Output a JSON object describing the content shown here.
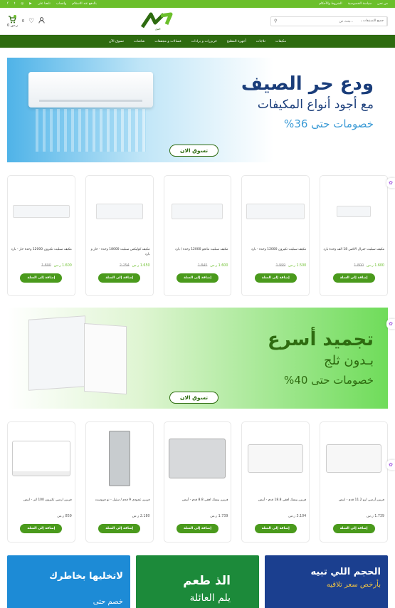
{
  "topbar": {
    "left_links": [
      "من نحن",
      "سياسة الخصوصية",
      "الشروط والأحكام"
    ],
    "right_info": [
      "تابعنا على",
      "واتساب",
      "بالدفع عند الاستلام"
    ]
  },
  "header": {
    "cart_amount": "0 ر.س",
    "cart_count": "0",
    "logo_text": "النيل",
    "search_category": "جميع التصنيفات",
    "search_placeholder": "بحث عن..."
  },
  "nav": [
    "مكيفات",
    "ثلاجات",
    "أجهزة المطبخ",
    "فريزرات و برادات",
    "غسالات و مجففات",
    "شاشات",
    "تسوق الآن"
  ],
  "banner1": {
    "headline": "ودع حر الصيف",
    "subline": "مع أجود أنواع المكيفات",
    "discount": "خصومات حتى 36%",
    "cta": "تسوق الان"
  },
  "banner2": {
    "headline": "تجميد أسرع",
    "subline": "بـدون ثلج",
    "discount": "خصومات حتى 40%",
    "cta": "تسوق الان"
  },
  "products_ac": [
    {
      "title": "مكيف سبليت جنرال الاكس 18 الف وحدة بارد",
      "old": "1.800",
      "new": "1.600 ر.س",
      "btn": "إضافة إلى السلة"
    },
    {
      "title": "مكيف سبليت تكيرون 12000 وحدة - بارد",
      "old": "1.999",
      "new": "1.500 ر.س",
      "btn": "إضافة إلى السلة"
    },
    {
      "title": "مكيف سبليت مانجو 12000 وحدة / بارد",
      "old": "1.845",
      "new": "1.600 ر.س",
      "btn": "إضافة إلى السلة"
    },
    {
      "title": "مكيف كوليكس سبليت 18000 وحدة - حار و بارد",
      "old": "2.254",
      "new": "1.650 ر.س",
      "btn": "إضافة إلى السلة"
    },
    {
      "title": "مكيف سبليت تكيرون 12000 وحدة حار - بارد",
      "old": "1.800",
      "new": "1.600 ر.س",
      "btn": "إضافة إلى السلة"
    }
  ],
  "products_fridge": [
    {
      "title": "فريزر أرضي ارو 11.2 قدم - ابيض",
      "new": "1.739 ر.س",
      "btn": "إضافة إلى السلة"
    },
    {
      "title": "فريزر بيسك افقي 18.8 قدم - أبيض",
      "new": "3.104 ر.س",
      "btn": "إضافة إلى السلة"
    },
    {
      "title": "فريزر بيسك افقي 8.8 قدم - أبيض",
      "new": "1.739 ر.س",
      "btn": "إضافة إلى السلة"
    },
    {
      "title": "فريزر عمودي 9 قدم / ستيل - نو فروست",
      "new": "2.180 ر.س",
      "btn": "إضافة إلى السلة"
    },
    {
      "title": "فريزر ارضي تكيرون 100 لتر - ابيض",
      "new": "859 ر.س",
      "btn": "إضافة إلى السلة"
    }
  ],
  "promos": [
    {
      "title": "الحجم اللي تبيه",
      "sub": "بأرخص سعر تلاقيه",
      "color": "#1b3f8f"
    },
    {
      "title": "الذ طعم",
      "sub": "يلم العائلة",
      "color": "#1c8a3a"
    },
    {
      "title": "لاتخليها بخاطرك",
      "sub": "خصم حتى",
      "color": "#1d8bd6"
    }
  ],
  "colors": {
    "brand": "#2e6b10",
    "accent": "#6bbf2b"
  }
}
